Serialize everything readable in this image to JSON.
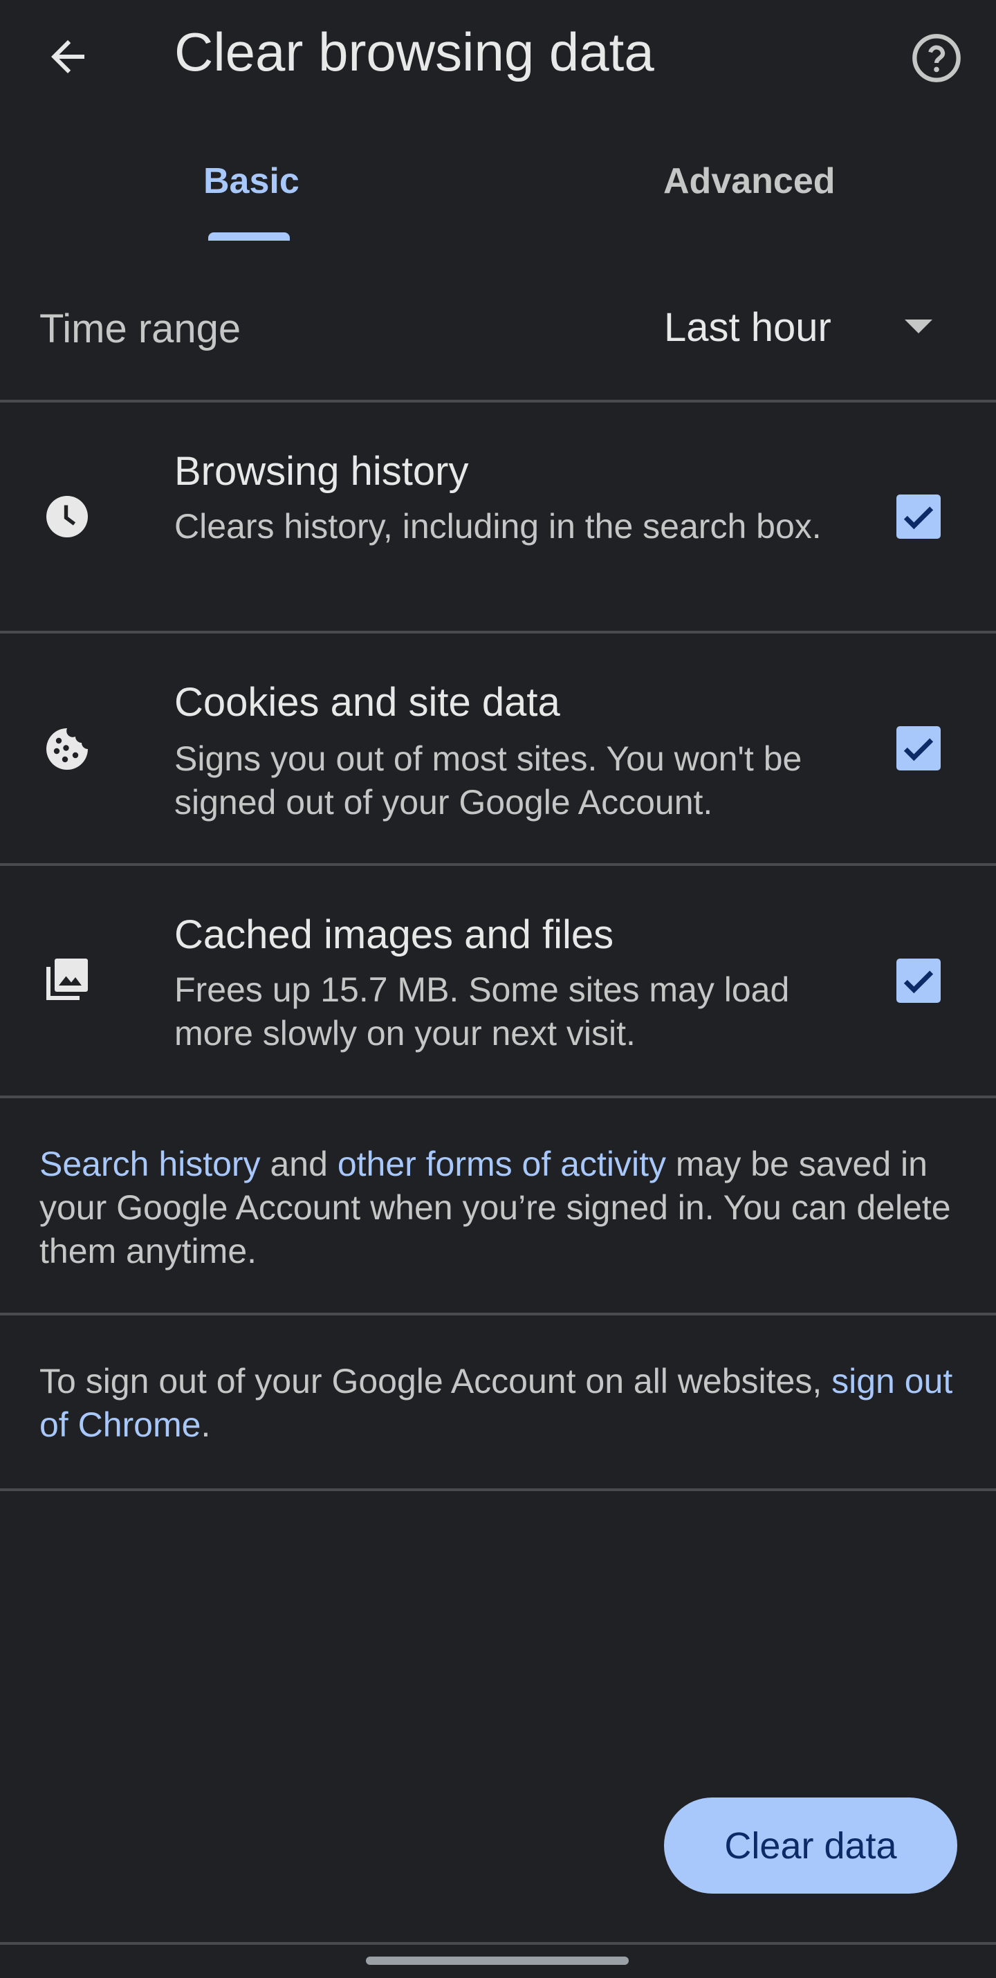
{
  "header": {
    "title": "Clear browsing data",
    "back_icon": "arrow-back-icon",
    "help_icon": "help-circle-icon"
  },
  "tabs": [
    {
      "label": "Basic",
      "selected": true
    },
    {
      "label": "Advanced",
      "selected": false
    }
  ],
  "time_range": {
    "label": "Time range",
    "value": "Last hour"
  },
  "items": [
    {
      "title": "Browsing history",
      "description": "Clears history, including in the search box.",
      "icon": "clock-icon",
      "checked": true
    },
    {
      "title": "Cookies and site data",
      "description": "Signs you out of most sites. You won't be signed out of your Google Account.",
      "icon": "cookie-icon",
      "checked": true
    },
    {
      "title": "Cached images and files",
      "description": "Frees up 15.7 MB. Some sites may load more slowly on your next visit.",
      "icon": "image-stack-icon",
      "checked": true
    }
  ],
  "info": {
    "link1": "Search history",
    "text1": " and ",
    "link2": "other forms of activity",
    "text2": " may be saved in your Google Account when you’re signed in. You can delete them anytime."
  },
  "signout": {
    "text": "To sign out of your Google Account on all websites, ",
    "link": "sign out of Chrome",
    "end": "."
  },
  "button": {
    "label": "Clear data"
  },
  "colors": {
    "background": "#202124",
    "accent": "#a8c7fa",
    "button_text": "#0b2a66"
  }
}
